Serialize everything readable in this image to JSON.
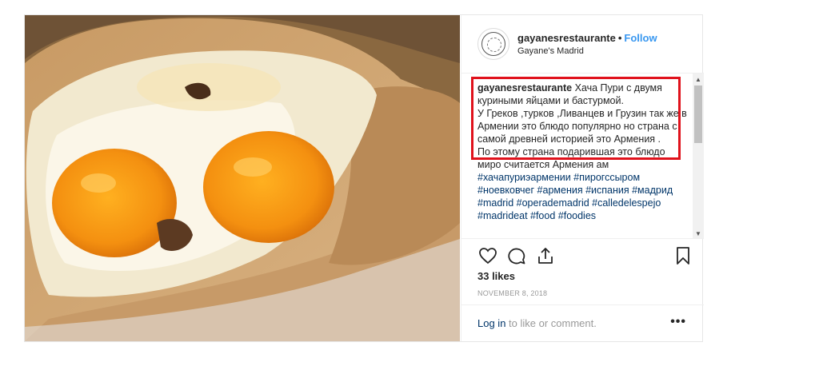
{
  "post": {
    "photo_alt": "",
    "header": {
      "username": "gayanesrestaurante",
      "separator": "•",
      "follow_label": "Follow",
      "location": "Gayane's Madrid"
    },
    "caption": {
      "username": "gayanesrestaurante",
      "line1": "Хача Пури с двумя куриными яйцами и бастурмой.",
      "line2": "У Греков ,турков ,Ливанцев и Грузин так же в Армении это блюдо популярно но страна с самой древней историей это Армения .",
      "line3": "По этому страна подарившая это блюдо миро считается Армения ам",
      "hashtags": "#хачапуриэармении #пирогссыром #ноевковчег #армения #испания #мадрид #madrid #operademadrid #calledelespejo #madrideat #food #foodies"
    },
    "actions": {
      "like_icon": "heart-icon",
      "comment_icon": "comment-icon",
      "share_icon": "share-icon",
      "save_icon": "bookmark-icon"
    },
    "likes": "33 likes",
    "date": "NOVEMBER 8, 2018",
    "comment_bar": {
      "login_link": "Log in",
      "login_text": " to like or comment.",
      "more_label": "•••"
    },
    "colors": {
      "accent": "#3897f0",
      "highlight": "#e0121c",
      "hashtag": "#003569"
    }
  }
}
